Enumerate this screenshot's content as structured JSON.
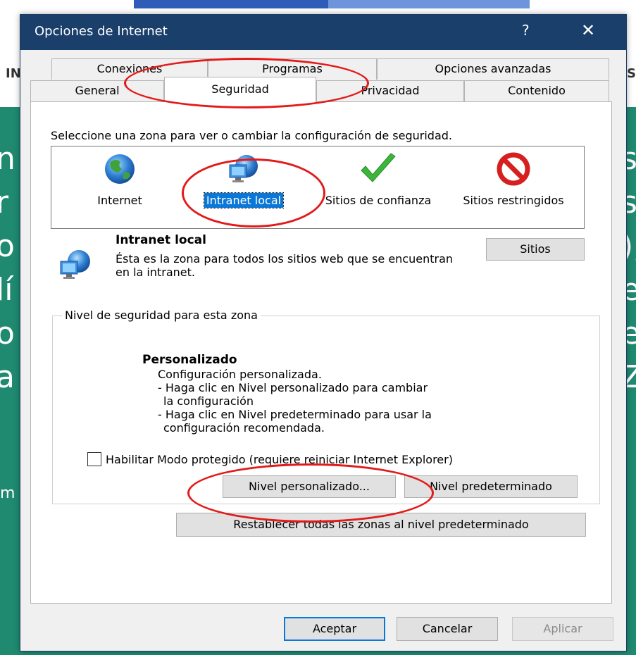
{
  "window": {
    "title": "Opciones de Internet",
    "help": "?",
    "close": "✕"
  },
  "tabs_row1": [
    {
      "label": "Conexiones"
    },
    {
      "label": "Programas"
    },
    {
      "label": "Opciones avanzadas"
    }
  ],
  "tabs_row2": [
    {
      "label": "General"
    },
    {
      "label": "Seguridad"
    },
    {
      "label": "Privacidad"
    },
    {
      "label": "Contenido"
    }
  ],
  "security": {
    "instruction": "Seleccione una zona para ver o cambiar la configuración de seguridad.",
    "zones": [
      {
        "label": "Internet",
        "icon": "globe-icon"
      },
      {
        "label": "Intranet local",
        "icon": "intranet-globe-icon",
        "selected": true
      },
      {
        "label": "Sitios de confianza",
        "icon": "checkmark-icon"
      },
      {
        "label": "Sitios restringidos",
        "icon": "prohibited-icon"
      }
    ],
    "zone_detail": {
      "title": "Intranet local",
      "description": "Ésta es la zona para todos los sitios web que se encuentran en la intranet.",
      "sites_button": "Sitios"
    },
    "level_group": {
      "legend": "Nivel de seguridad para esta zona",
      "level_title": "Personalizado",
      "level_desc": [
        "Configuración personalizada.",
        "- Haga clic en Nivel personalizado para cambiar",
        "  la configuración",
        "- Haga clic en Nivel predeterminado para usar la",
        "  configuración recomendada."
      ],
      "protected_mode_label": "Habilitar Modo protegido (requiere reiniciar Internet Explorer)",
      "custom_level_button": "Nivel personalizado...",
      "default_level_button": "Nivel predeterminado"
    },
    "reset_all_button": "Restablecer todas las zonas al nivel predeterminado"
  },
  "footer": {
    "ok": "Aceptar",
    "cancel": "Cancelar",
    "apply": "Aplicar"
  },
  "background": {
    "side_left": "IN",
    "side_right": "S",
    "letters_left": [
      "n",
      "r",
      "o",
      "lí",
      "o",
      "a"
    ],
    "letters_right": [
      "s",
      "s",
      "),",
      "e",
      "e",
      "Z"
    ],
    "small_left": "m"
  },
  "colors": {
    "titlebar": "#1b3f6b",
    "accent": "#0b78d7",
    "annotation": "#e31a1a",
    "page_bg": "#1f8a70"
  }
}
